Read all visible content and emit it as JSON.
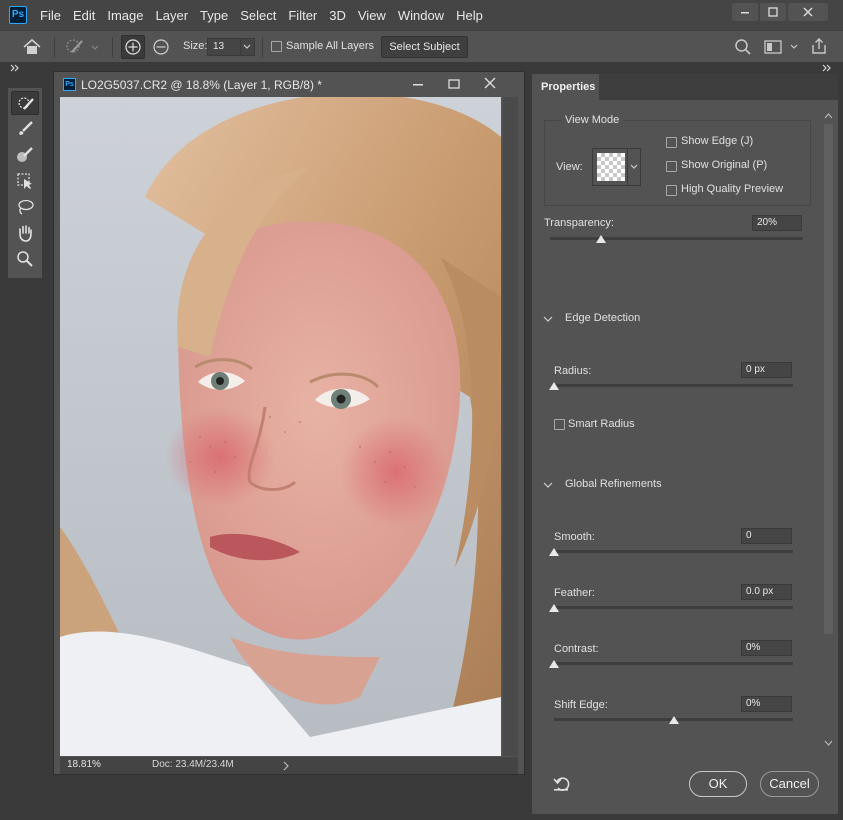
{
  "app": {
    "logo": "Ps"
  },
  "menu": [
    "File",
    "Edit",
    "Image",
    "Layer",
    "Type",
    "Select",
    "Filter",
    "3D",
    "View",
    "Window",
    "Help"
  ],
  "options_bar": {
    "size_label": "Size:",
    "size_value": "13",
    "sample_all_layers": "Sample All Layers",
    "select_subject": "Select Subject"
  },
  "document": {
    "title": "LO2G5037.CR2 @ 18.8% (Layer 1, RGB/8) *",
    "zoom": "18.81%",
    "doc_info": "Doc: 23.4M/23.4M"
  },
  "properties": {
    "tab": "Properties",
    "view_mode": {
      "title": "View Mode",
      "view_label": "View:",
      "show_edge": "Show Edge (J)",
      "show_original": "Show Original (P)",
      "high_quality": "High Quality Preview"
    },
    "transparency": {
      "label": "Transparency:",
      "value": "20%",
      "level": 0.2
    },
    "edge_detection": {
      "title": "Edge Detection",
      "radius": {
        "label": "Radius:",
        "value": "0 px",
        "level": 0
      },
      "smart_radius": "Smart Radius"
    },
    "global_refinements": {
      "title": "Global Refinements",
      "smooth": {
        "label": "Smooth:",
        "value": "0",
        "level": 0
      },
      "feather": {
        "label": "Feather:",
        "value": "0.0 px",
        "level": 0
      },
      "contrast": {
        "label": "Contrast:",
        "value": "0%",
        "level": 0
      },
      "shift_edge": {
        "label": "Shift Edge:",
        "value": "0%",
        "level": 0.5
      }
    },
    "ok": "OK",
    "cancel": "Cancel"
  },
  "colors": {
    "panel": "#535353",
    "background": "#3a3a3a",
    "menubar": "#454545",
    "accent_ps": "#31a8ff"
  }
}
